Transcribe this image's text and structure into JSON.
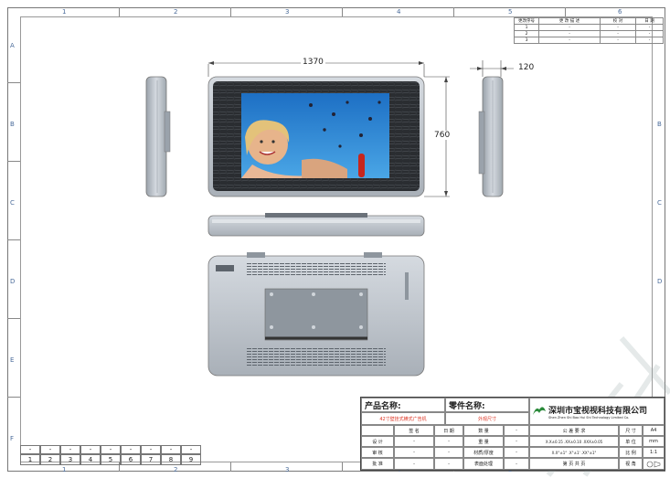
{
  "grid": {
    "columns": [
      "1",
      "2",
      "3",
      "4",
      "5",
      "6"
    ],
    "rows": [
      "A",
      "B",
      "C",
      "D",
      "E",
      "F"
    ]
  },
  "dimensions": {
    "width": "1370",
    "height": "760",
    "depth": "120"
  },
  "revision_table": {
    "headers": [
      "更改序号",
      "更 改 描 述",
      "校 对",
      "日 期"
    ],
    "rows": [
      [
        "1",
        "-",
        "-",
        "-"
      ],
      [
        "2",
        "-",
        "-",
        "-"
      ],
      [
        "3",
        "-",
        "-",
        "-"
      ]
    ]
  },
  "title_block": {
    "product_name_label": "产品名称:",
    "part_name_label": "零件名称:",
    "product_name_value": "42寸壁挂式横式广告机",
    "part_name_value": "外观尺寸",
    "company_name_cn": "深圳市宝视视科技有限公司",
    "company_name_en": "Shen Zhen Shi Bao Hui Shi Technology Limited Co.",
    "sign_header": "签 名",
    "date_header": "日 期",
    "quantity_label": "数 量",
    "weight_label": "重 量",
    "material_label": "材质/厚度",
    "surface_label": "表面处理",
    "design_label": "设 计",
    "review_label": "审 核",
    "approve_label": "批 准",
    "tolerance_line1": "X.X±0.15  .XX±0.10  .XXX±0.05",
    "tolerance_line2": "X.X°±1°  .X°±1'  .XX°±1\"",
    "general_tolerance": "公 差 要 求",
    "size_label": "尺 寸",
    "size_value": "A4",
    "unit_label": "单 位",
    "unit_value": "mm",
    "scale_label": "比 例",
    "scale_value": "1:1",
    "sheet_text": "第 页 共 页",
    "view_label": "视 角",
    "dash": "-"
  },
  "number_strip": {
    "top": [
      "-",
      "-",
      "-",
      "-",
      "-",
      "-",
      "-",
      "-",
      "-"
    ],
    "bottom": [
      "1",
      "2",
      "3",
      "4",
      "5",
      "6",
      "7",
      "8",
      "9"
    ]
  },
  "colors": {
    "device_body": "#b9c0c8",
    "bezel_dark": "#2c2f33",
    "screen_blue": "#2a7fd0",
    "grid_label": "#4a6b9a",
    "highlight_red": "#d32f2f"
  }
}
